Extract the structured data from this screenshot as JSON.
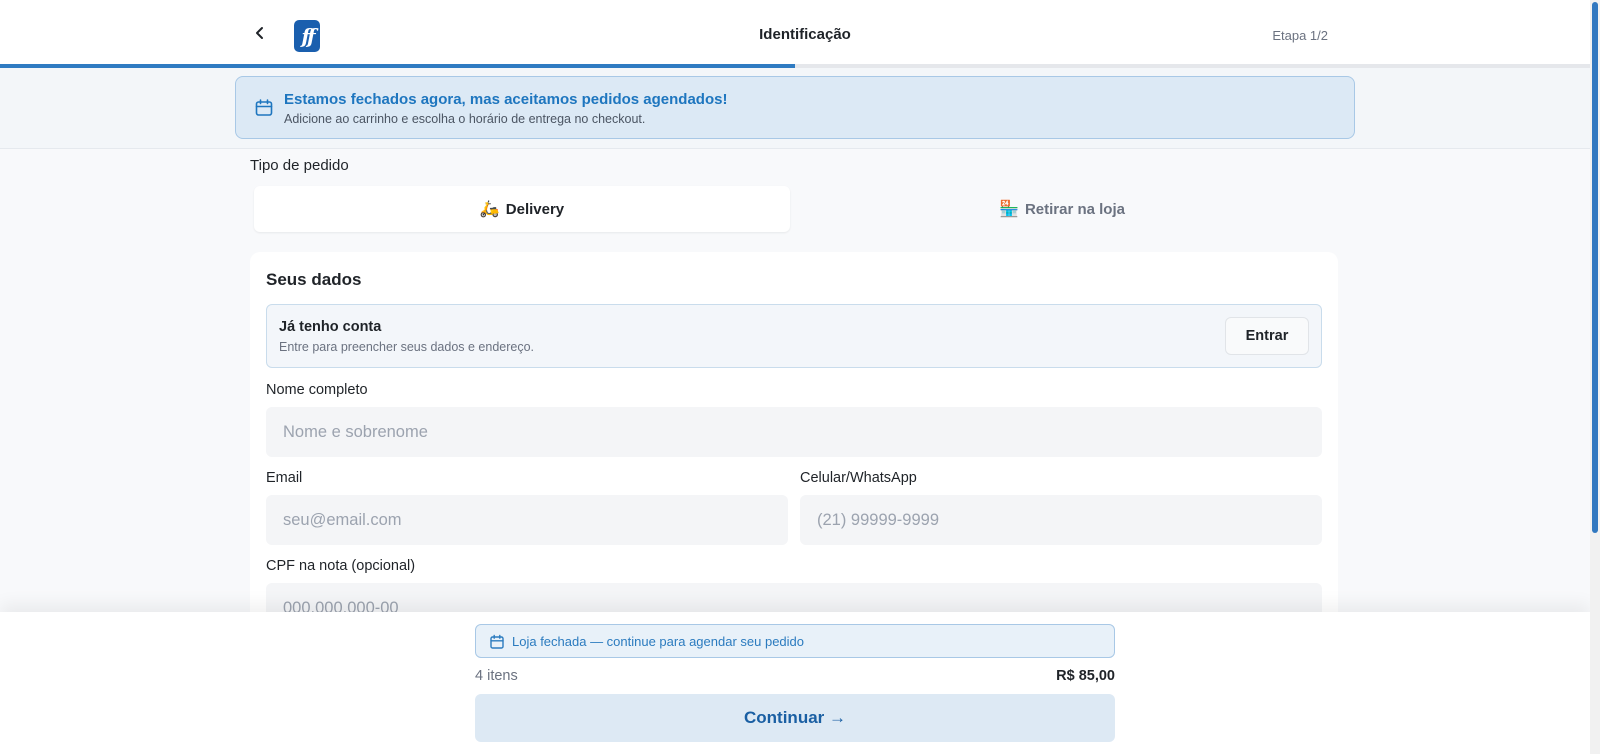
{
  "header": {
    "title": "Identificação",
    "step": "Etapa 1/2",
    "logo_text": "ff",
    "progress": 0.5
  },
  "closed_banner": {
    "title": "Estamos fechados agora, mas aceitamos pedidos agendados!",
    "subtitle": "Adicione ao carrinho e escolha o horário de entrega no checkout."
  },
  "order_type": {
    "label": "Tipo de pedido",
    "options": [
      {
        "label": "Delivery",
        "emoji": "🛵",
        "selected": true
      },
      {
        "label": "Retirar na loja",
        "emoji": "🏪",
        "selected": false
      }
    ]
  },
  "form": {
    "title": "Seus dados",
    "account": {
      "title": "Já tenho conta",
      "subtitle": "Entre para preencher seus dados e endereço.",
      "login_label": "Entrar"
    },
    "fields": {
      "name": {
        "label": "Nome completo",
        "placeholder": "Nome e sobrenome",
        "value": ""
      },
      "email": {
        "label": "Email",
        "placeholder": "seu@email.com",
        "value": ""
      },
      "phone": {
        "label": "Celular/WhatsApp",
        "placeholder": "(21) 99999-9999",
        "value": ""
      },
      "cpf": {
        "label": "CPF na nota (opcional)",
        "placeholder": "000.000.000-00",
        "value": ""
      }
    }
  },
  "footer": {
    "alert": "Loja fechada — continue para agendar seu pedido",
    "items_count": "4 itens",
    "total": "R$ 85,00",
    "continue_label": "Continuar →"
  },
  "colors": {
    "accent": "#2f7bc2",
    "banner_bg": "#dce9f5",
    "banner_text": "#1e76bf"
  }
}
